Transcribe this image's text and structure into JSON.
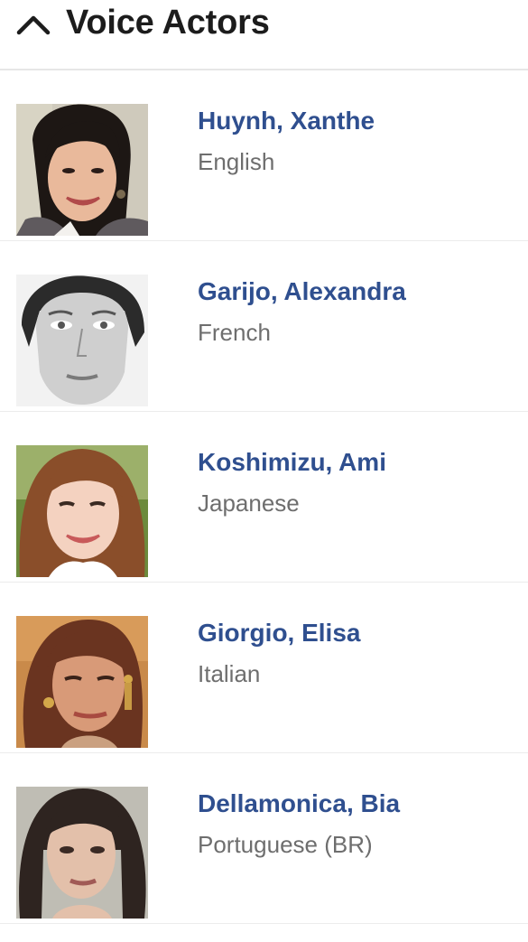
{
  "section": {
    "title": "Voice Actors",
    "toggle_icon": "chevron-up-icon"
  },
  "actors": [
    {
      "name": "Huynh, Xanthe",
      "language": "English",
      "photo": "photo-xanthe-huynh"
    },
    {
      "name": "Garijo, Alexandra",
      "language": "French",
      "photo": "photo-alexandra-garijo"
    },
    {
      "name": "Koshimizu, Ami",
      "language": "Japanese",
      "photo": "photo-ami-koshimizu"
    },
    {
      "name": "Giorgio, Elisa",
      "language": "Italian",
      "photo": "photo-elisa-giorgio"
    },
    {
      "name": "Dellamonica, Bia",
      "language": "Portuguese (BR)",
      "photo": "photo-bia-dellamonica"
    }
  ],
  "colors": {
    "name_link": "#2f4f8f",
    "language_text": "#6e6e6e",
    "title_text": "#1c1c1c",
    "divider": "#ececec"
  }
}
